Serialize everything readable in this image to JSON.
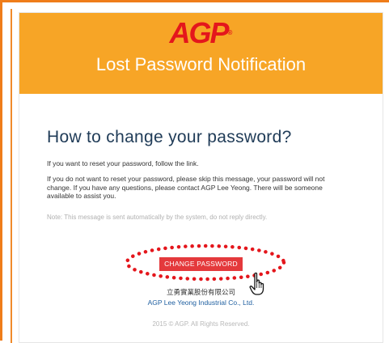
{
  "header": {
    "logo_text": "AGP",
    "logo_mark": "®",
    "title": "Lost Password Notification"
  },
  "content": {
    "heading": "How to change your password?",
    "paragraph_1": "If you want to reset your password, follow the link.",
    "paragraph_2": "If you do not want to reset your password, please skip this message, your password will not change. If you have any questions, please contact AGP Lee Yeong. There will be someone available to assist you.",
    "note": "Note: This message is sent automatically by the system, do not reply directly."
  },
  "cta": {
    "label": "CHANGE PASSWORD"
  },
  "footer": {
    "company_cn": "立勇實業股份有限公司",
    "company_en": "AGP Lee Yeong Industrial Co., Ltd.",
    "copyright": "2015 © AGP. All Rights Reserved."
  },
  "icons": {
    "cursor": "hand-pointer-icon",
    "annotation": "dotted-ellipse-highlight"
  },
  "colors": {
    "frame": "#ef7d1a",
    "banner": "#f7a526",
    "logo": "#e4161c",
    "button": "#e4393c",
    "heading": "#1f3b57",
    "highlight": "#e4161c"
  }
}
